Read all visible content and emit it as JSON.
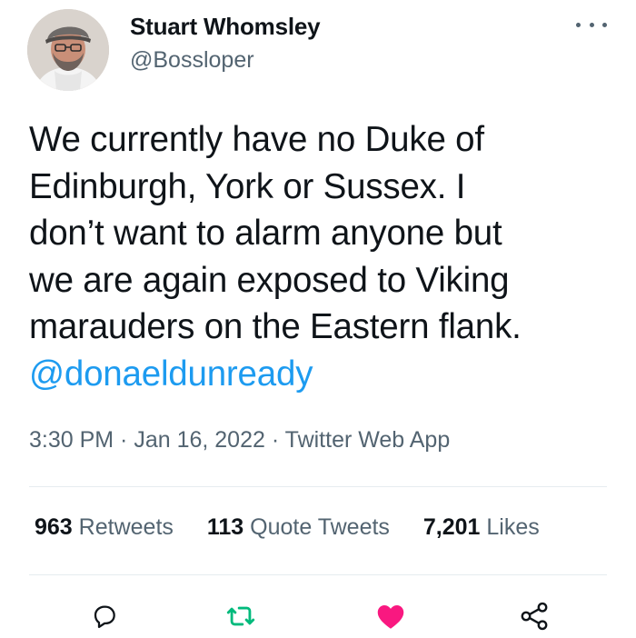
{
  "author": {
    "display_name": "Stuart Whomsley",
    "handle": "@Bossloper"
  },
  "tweet": {
    "lines": [
      "We currently have no Duke of",
      "Edinburgh, York or Sussex. I",
      "don’t want to alarm anyone but",
      "we are again exposed to Viking",
      "marauders on the Eastern flank."
    ],
    "mention": "@donaeldunready"
  },
  "meta": {
    "time": "3:30 PM",
    "separator1": " · ",
    "date": "Jan 16, 2022",
    "separator2": " · ",
    "source": "Twitter Web App"
  },
  "stats": {
    "retweets_count": "963",
    "retweets_label": "Retweets",
    "quotes_count": "113",
    "quotes_label": "Quote Tweets",
    "likes_count": "7,201",
    "likes_label": "Likes"
  },
  "icons": {
    "reply": "reply-icon",
    "retweet": "retweet-icon",
    "like": "heart-icon",
    "share": "share-icon",
    "more": "more-icon"
  },
  "colors": {
    "text": "#0f1419",
    "secondary": "#536471",
    "link": "#1d9bf0",
    "retweet_green": "#00ba7c",
    "like_pink": "#f91880"
  }
}
